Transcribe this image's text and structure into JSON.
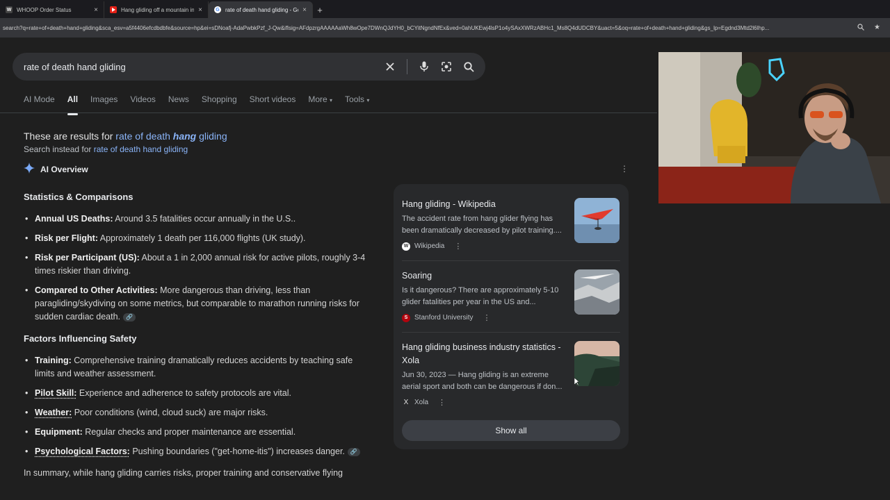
{
  "browser": {
    "tabs": [
      {
        "title": "WHOOP Order Status",
        "favicon": "W"
      },
      {
        "title": "Hang gliding off a mountain in",
        "favicon": "youtube-icon"
      },
      {
        "title": "rate of death hand gliding - Go",
        "favicon": "google-icon"
      }
    ],
    "url": "search?q=rate+of+death+hand+gliding&sca_esv=a5f4406efcdbdbfe&source=hp&ei=sDNoafj-AdaPwbkPzf_J-Qw&iflsig=AFdpzrgAAAAAaWh8wOpe7DWnQJdYH0_bCYitNgndNfEx&ved=0ahUKEwj4lsP1o4ySAxXWRzABHc1_Ms8Q4dUDCBY&uact=5&oq=rate+of+death+hand+gliding&gs_lp=Egdnd3Mtd2l6Ihp..."
  },
  "search": {
    "query": "rate of death hand gliding"
  },
  "nav_tabs": [
    "AI Mode",
    "All",
    "Images",
    "Videos",
    "News",
    "Shopping",
    "Short videos",
    "More",
    "Tools"
  ],
  "notice": {
    "prefix": "These are results for ",
    "corrected_pre": "rate of death ",
    "corrected_bold": "hang",
    "corrected_post": " gliding",
    "instead_prefix": "Search instead for ",
    "instead_link": "rate of death hand gliding"
  },
  "ai_overview": {
    "label": "AI Overview",
    "section1_title": "Statistics & Comparisons",
    "section1_items": [
      {
        "label": "Annual US Deaths:",
        "text": " Around 3.5 fatalities occur annually in the U.S.."
      },
      {
        "label": "Risk per Flight:",
        "text": " Approximately 1 death per 116,000 flights (UK study)."
      },
      {
        "label": "Risk per Participant (US):",
        "text": " About a 1 in 2,000 annual risk for active pilots, roughly 3-4 times riskier than driving."
      },
      {
        "label": "Compared to Other Activities:",
        "text": " More dangerous than driving, less than paragliding/skydiving on some metrics, but comparable to marathon running risks for sudden cardiac death."
      }
    ],
    "section2_title": "Factors Influencing Safety",
    "section2_items": [
      {
        "label": "Training:",
        "text": " Comprehensive training dramatically reduces accidents by teaching safe limits and weather assessment."
      },
      {
        "label": "Pilot Skill:",
        "text": " Experience and adherence to safety protocols are vital."
      },
      {
        "label": "Weather:",
        "text": " Poor conditions (wind, cloud suck) are major risks."
      },
      {
        "label": "Equipment:",
        "text": " Regular checks and proper maintenance are essential."
      },
      {
        "label": "Psychological Factors:",
        "text": " Pushing boundaries (\"get-home-itis\") increases danger."
      }
    ],
    "summary": "In summary, while hang gliding carries risks, proper training and conservative flying"
  },
  "sources": [
    {
      "title": "Hang gliding - Wikipedia",
      "desc": "The accident rate from hang glider flying has been dramatically decreased by pilot training....",
      "site": "Wikipedia",
      "favicon": "W"
    },
    {
      "title": "Soaring",
      "desc": "Is it dangerous? There are approximately 5-10 glider fatalities per year in the US and...",
      "site": "Stanford University",
      "favicon": "S"
    },
    {
      "title": "Hang gliding business industry statistics - Xola",
      "desc": "Jun 30, 2023 — Hang gliding is an extreme aerial sport and both can be dangerous if don...",
      "site": "Xola",
      "favicon": "X"
    }
  ],
  "show_all": "Show all",
  "colors": {
    "link": "#8ab4f8",
    "bg": "#1f1f1f",
    "panel": "#28292b"
  }
}
